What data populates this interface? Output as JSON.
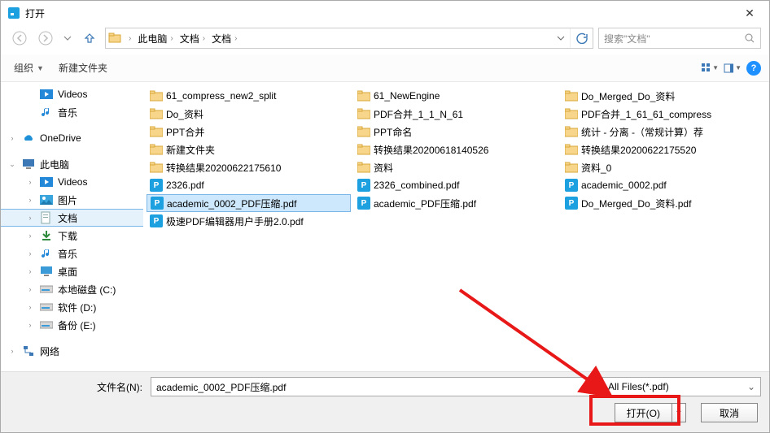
{
  "titlebar": {
    "title": "打开"
  },
  "breadcrumb": {
    "parts": [
      "此电脑",
      "文档",
      "文档"
    ]
  },
  "search": {
    "placeholder": "搜索\"文档\""
  },
  "toolbar": {
    "organize": "组织",
    "newfolder": "新建文件夹"
  },
  "tree": {
    "videos": "Videos",
    "music": "音乐",
    "onedrive": "OneDrive",
    "thispc": "此电脑",
    "childVideos": "Videos",
    "childPictures": "图片",
    "childDocuments": "文档",
    "childDownloads": "下载",
    "childMusic": "音乐",
    "childDesktop": "桌面",
    "childDiskC": "本地磁盘 (C:)",
    "childDiskD": "软件 (D:)",
    "childDiskE": "备份 (E:)",
    "network": "网络"
  },
  "files": {
    "c1r1": "61_compress_new2_split",
    "c2r1": "61_NewEngine",
    "c3r1": "Do_Merged_Do_资料",
    "c1r2": "Do_资料",
    "c2r2": "PDF合并_1_1_N_61",
    "c3r2": "PDF合并_1_61_61_compress",
    "c1r3": "PPT合并",
    "c2r3": "PPT命名",
    "c3r3": "统计 - 分离 -（常规计算）荐",
    "c1r4": "新建文件夹",
    "c2r4": "转换结果20200618140526",
    "c3r4": "转换结果20200622175520",
    "c1r5": "转换结果20200622175610",
    "c2r5": "资料",
    "c3r5": "资料_0",
    "c1r6": "2326.pdf",
    "c2r6": "2326_combined.pdf",
    "c3r6": "academic_0002.pdf",
    "c1r7": "academic_0002_PDF压缩.pdf",
    "c2r7": "academic_PDF压缩.pdf",
    "c3r7": "Do_Merged_Do_资料.pdf",
    "c1r8": "极速PDF编辑器用户手册2.0.pdf"
  },
  "footer": {
    "filelabel": "文件名(N):",
    "filename": "academic_0002_PDF压缩.pdf",
    "filter": "All Files(*.pdf)",
    "open": "打开(O)",
    "cancel": "取消"
  }
}
